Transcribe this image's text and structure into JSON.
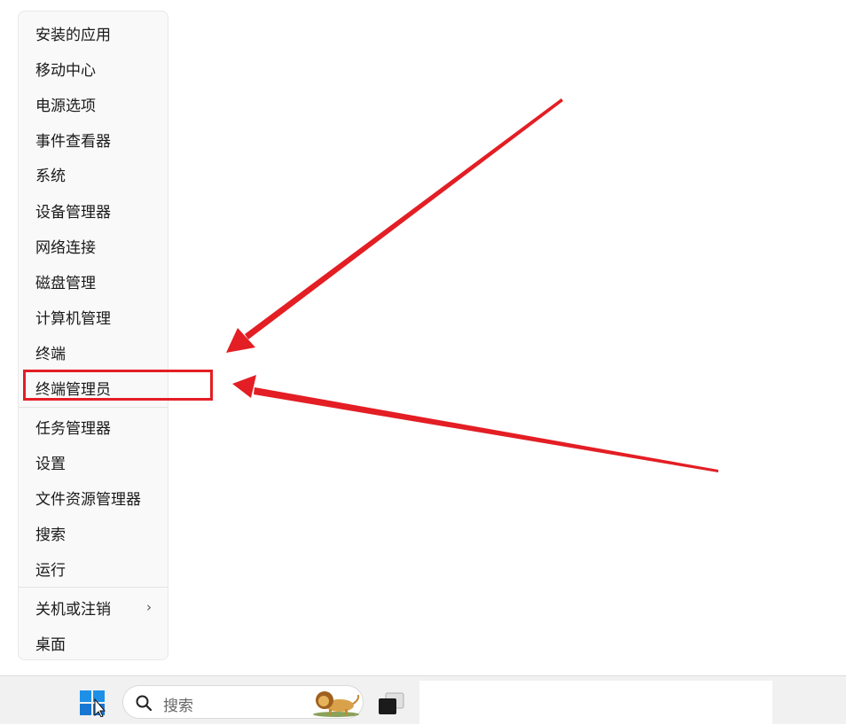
{
  "context_menu": {
    "items": [
      {
        "label": "安装的应用"
      },
      {
        "label": "移动中心"
      },
      {
        "label": "电源选项"
      },
      {
        "label": "事件查看器"
      },
      {
        "label": "系统"
      },
      {
        "label": "设备管理器"
      },
      {
        "label": "网络连接"
      },
      {
        "label": "磁盘管理"
      },
      {
        "label": "计算机管理"
      },
      {
        "label": "终端"
      },
      {
        "label": "终端管理员",
        "highlighted": true
      },
      {
        "label": "任务管理器"
      },
      {
        "label": "设置"
      },
      {
        "label": "文件资源管理器"
      },
      {
        "label": "搜索"
      },
      {
        "label": "运行"
      },
      {
        "label": "关机或注销",
        "submenu_icon": "chevron-right-icon"
      },
      {
        "label": "桌面"
      }
    ],
    "submenu_chevron": "›"
  },
  "annotation": {
    "color": "#e31e24",
    "target": "终端管理员"
  },
  "taskbar": {
    "start_icon": "windows-logo-icon",
    "search_placeholder": "搜索",
    "search_icon": "search-icon",
    "search_highlight_icon": "lion-icon",
    "task_view_icon": "task-view-icon"
  }
}
